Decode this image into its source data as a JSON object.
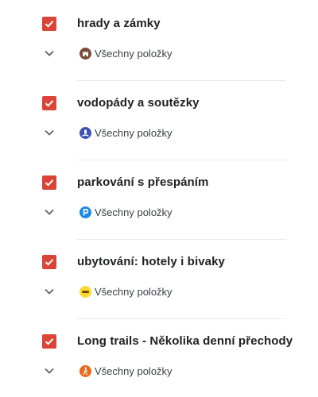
{
  "layers": [
    {
      "title": "hrady a zámky",
      "item_label": "Všechny položky",
      "icon": "castle-icon",
      "icon_color": "#7b4a3a",
      "checked": true
    },
    {
      "title": "vodopády a soutězky",
      "item_label": "Všechny položky",
      "icon": "waterfall-icon",
      "icon_color": "#3f51b5",
      "checked": true
    },
    {
      "title": "parkování s přespáním",
      "item_label": "Všechny položky",
      "icon": "parking-icon",
      "icon_color": "#1e88e5",
      "checked": true
    },
    {
      "title": "ubytování: hotely i bivaky",
      "item_label": "Všechny položky",
      "icon": "bed-icon",
      "icon_color": "#fdd835",
      "checked": true
    },
    {
      "title": "Long trails - Několika denní přechody",
      "item_label": "Všechny položky",
      "icon": "hiker-icon",
      "icon_color": "#e8691c",
      "checked": true
    }
  ],
  "colors": {
    "checkbox": "#db4437",
    "chevron": "#5f6368",
    "divider": "#e8eaed"
  }
}
